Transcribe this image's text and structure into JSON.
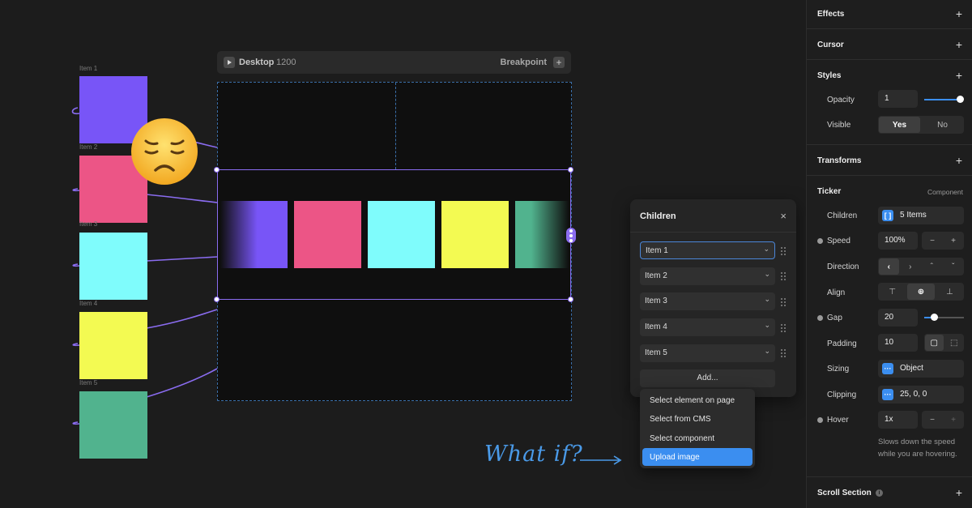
{
  "canvas": {
    "items": [
      {
        "label": "Item 1",
        "color": "#7855f7"
      },
      {
        "label": "Item 2",
        "color": "#ec5586"
      },
      {
        "label": "Item 3",
        "color": "#7ffcfc"
      },
      {
        "label": "Item 4",
        "color": "#f3fa52"
      },
      {
        "label": "Item 5",
        "color": "#51b38e"
      }
    ],
    "frame_bar": {
      "device": "Desktop",
      "width": "1200",
      "breakpoint": "Breakpoint"
    },
    "annotation": "What if?"
  },
  "children_panel": {
    "title": "Children",
    "rows": [
      "Item 1",
      "Item 2",
      "Item 3",
      "Item 4",
      "Item 5"
    ],
    "add_label": "Add...",
    "menu": [
      "Select element on page",
      "Select from CMS",
      "Select component",
      "Upload image"
    ]
  },
  "panel": {
    "effects": "Effects",
    "cursor": "Cursor",
    "styles": "Styles",
    "opacity_label": "Opacity",
    "opacity_value": "1",
    "visible_label": "Visible",
    "visible_yes": "Yes",
    "visible_no": "No",
    "transforms": "Transforms",
    "ticker": "Ticker",
    "ticker_tag": "Component",
    "children_label": "Children",
    "children_value": "5 Items",
    "speed_label": "Speed",
    "speed_value": "100%",
    "direction_label": "Direction",
    "align_label": "Align",
    "gap_label": "Gap",
    "gap_value": "20",
    "padding_label": "Padding",
    "padding_value": "10",
    "sizing_label": "Sizing",
    "sizing_value": "Object",
    "clipping_label": "Clipping",
    "clipping_value": "25, 0, 0",
    "hover_label": "Hover",
    "hover_value": "1x",
    "hover_note": "Slows down the speed while you are hovering.",
    "scroll_section": "Scroll Section"
  }
}
